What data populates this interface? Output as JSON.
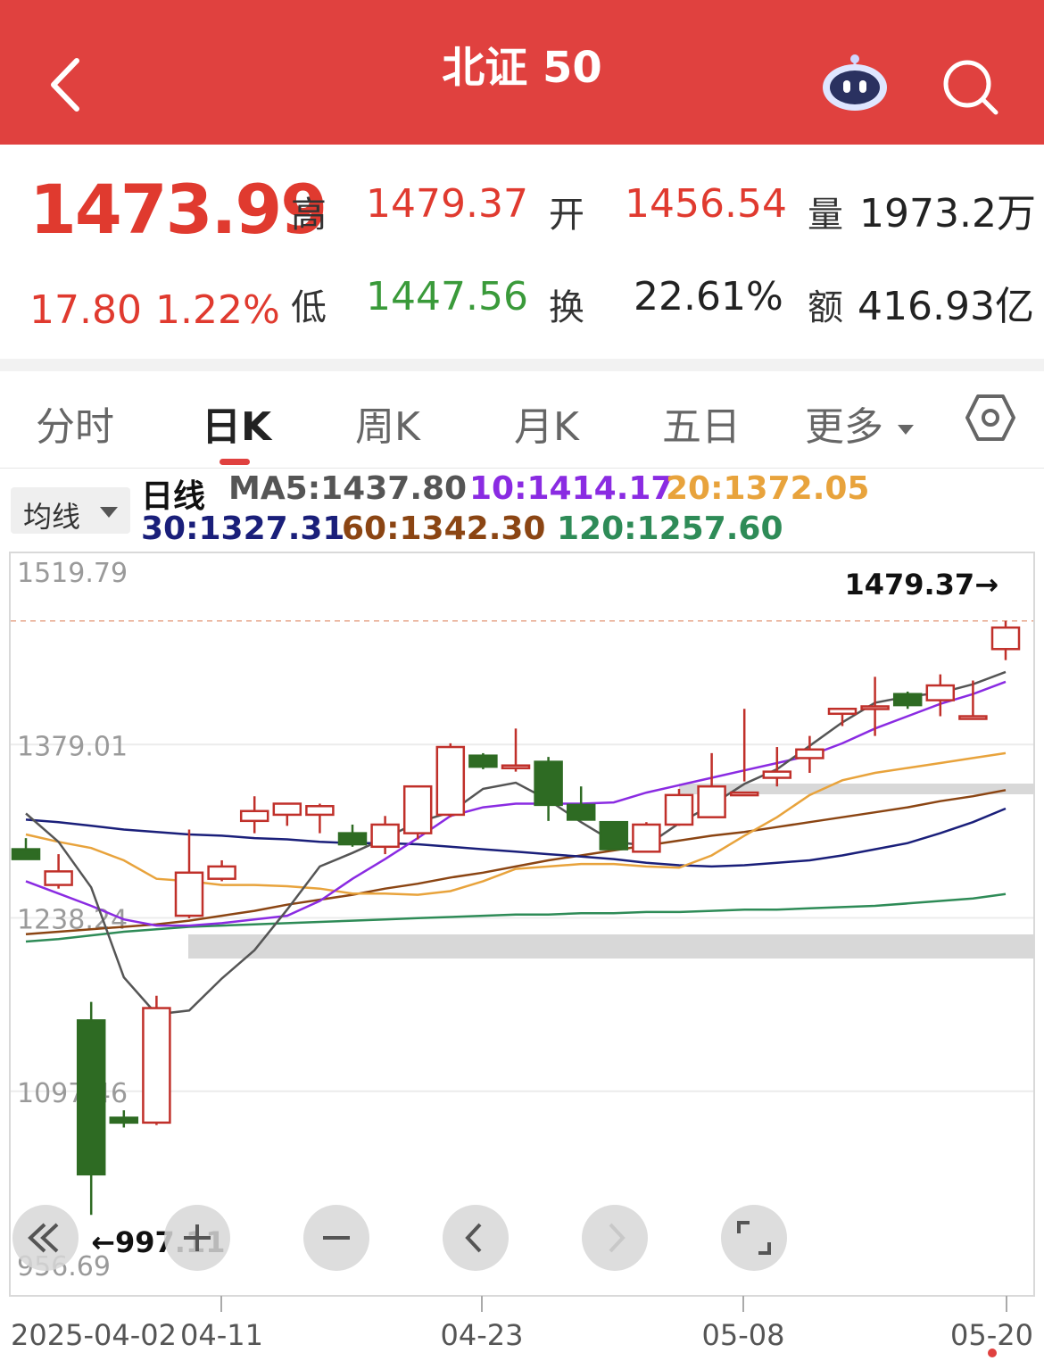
{
  "header": {
    "title": "北证 50"
  },
  "quote": {
    "price": "1473.99",
    "change": "17.80",
    "change_pct": "1.22%",
    "high_label": "高",
    "high": "1479.37",
    "open_label": "开",
    "open": "1456.54",
    "volume_label": "量",
    "volume": "1973.2万",
    "low_label": "低",
    "low": "1447.56",
    "turnover_label": "换",
    "turnover": "22.61%",
    "amount_label": "额",
    "amount": "416.93亿"
  },
  "tabs": [
    {
      "label": "分时"
    },
    {
      "label": "日K"
    },
    {
      "label": "周K"
    },
    {
      "label": "月K"
    },
    {
      "label": "五日"
    },
    {
      "label": "更多"
    }
  ],
  "ma_button": "均线",
  "ma_legend": {
    "period": "日线",
    "ma5": "MA5:1437.80",
    "ma10": "10:1414.17",
    "ma20": "20:1372.05",
    "ma30": "30:1327.31",
    "ma60": "60:1342.30",
    "ma120": "120:1257.60"
  },
  "colors": {
    "up": "#c0302a",
    "down": "#2e6b23",
    "ma5": "#555555",
    "ma10": "#8a2be2",
    "ma20": "#e8a33c",
    "ma30": "#1a1f7a",
    "ma60": "#8b4513",
    "ma120": "#2e8b57",
    "header": "#e0413f"
  },
  "chart_data": {
    "type": "candlestick",
    "y_ticks": [
      "1519.79",
      "1379.01",
      "1238.24",
      "1097.46",
      "956.69"
    ],
    "ylim": [
      956.69,
      1519.79
    ],
    "x_tick_labels": [
      "2025-04-02",
      "04-11",
      "04-23",
      "05-08",
      "05-20"
    ],
    "max_annotation": "1479.37→",
    "min_annotation": "←997.11",
    "candles": [
      {
        "o": 1294,
        "h": 1303,
        "l": 1286,
        "c": 1286
      },
      {
        "o": 1265,
        "h": 1290,
        "l": 1262,
        "c": 1276
      },
      {
        "o": 1155,
        "h": 1170,
        "l": 997.11,
        "c": 1030
      },
      {
        "o": 1076,
        "h": 1082,
        "l": 1068,
        "c": 1072
      },
      {
        "o": 1072,
        "h": 1175,
        "l": 1070,
        "c": 1165
      },
      {
        "o": 1240,
        "h": 1310,
        "l": 1238,
        "c": 1275
      },
      {
        "o": 1270,
        "h": 1285,
        "l": 1268,
        "c": 1280
      },
      {
        "o": 1317,
        "h": 1337,
        "l": 1307,
        "c": 1325
      },
      {
        "o": 1322,
        "h": 1331,
        "l": 1313,
        "c": 1331
      },
      {
        "o": 1322,
        "h": 1331,
        "l": 1307,
        "c": 1329
      },
      {
        "o": 1307,
        "h": 1314,
        "l": 1296,
        "c": 1298
      },
      {
        "o": 1296,
        "h": 1321,
        "l": 1290,
        "c": 1314
      },
      {
        "o": 1307,
        "h": 1338,
        "l": 1302,
        "c": 1345
      },
      {
        "o": 1322,
        "h": 1380,
        "l": 1320,
        "c": 1377
      },
      {
        "o": 1370,
        "h": 1372,
        "l": 1359,
        "c": 1361
      },
      {
        "o": 1362,
        "h": 1392,
        "l": 1357,
        "c": 1362
      },
      {
        "o": 1365,
        "h": 1369,
        "l": 1317,
        "c": 1330
      },
      {
        "o": 1330,
        "h": 1345,
        "l": 1329,
        "c": 1318
      },
      {
        "o": 1316,
        "h": 1316,
        "l": 1294,
        "c": 1294
      },
      {
        "o": 1292,
        "h": 1316,
        "l": 1293,
        "c": 1314
      },
      {
        "o": 1314,
        "h": 1343,
        "l": 1313,
        "c": 1338
      },
      {
        "o": 1320,
        "h": 1372,
        "l": 1320,
        "c": 1345
      },
      {
        "o": 1340,
        "h": 1408,
        "l": 1349,
        "c": 1340
      },
      {
        "o": 1352,
        "h": 1377,
        "l": 1345,
        "c": 1357
      },
      {
        "o": 1368,
        "h": 1386,
        "l": 1356,
        "c": 1375
      },
      {
        "o": 1404,
        "h": 1408,
        "l": 1394,
        "c": 1408
      },
      {
        "o": 1409,
        "h": 1434,
        "l": 1386,
        "c": 1410
      },
      {
        "o": 1420,
        "h": 1422,
        "l": 1408,
        "c": 1411
      },
      {
        "o": 1415,
        "h": 1436,
        "l": 1402,
        "c": 1427
      },
      {
        "o": 1402,
        "h": 1431,
        "l": 1400,
        "c": 1402
      },
      {
        "o": 1456.54,
        "h": 1479.37,
        "l": 1447.56,
        "c": 1473.99
      }
    ],
    "ma5": [
      1323,
      1300,
      1263,
      1190,
      1160,
      1163,
      1189,
      1212,
      1245,
      1280,
      1291,
      1303,
      1316,
      1324,
      1343,
      1348,
      1334,
      1316,
      1300,
      1297,
      1315,
      1330,
      1347,
      1359,
      1378,
      1397,
      1413,
      1418,
      1421,
      1428,
      1438
    ],
    "ma10": [
      1268,
      1258,
      1248,
      1237,
      1232,
      1232,
      1234,
      1237,
      1240,
      1252,
      1270,
      1286,
      1303,
      1321,
      1328,
      1331,
      1331,
      1331,
      1332,
      1340,
      1346,
      1352,
      1358,
      1364,
      1370,
      1380,
      1392,
      1402,
      1412,
      1420,
      1430
    ],
    "ma20": [
      1306,
      1300,
      1295,
      1285,
      1270,
      1268,
      1265,
      1265,
      1264,
      1262,
      1258,
      1258,
      1257,
      1260,
      1268,
      1278,
      1280,
      1282,
      1282,
      1280,
      1279,
      1289,
      1305,
      1320,
      1338,
      1350,
      1356,
      1360,
      1364,
      1368,
      1372
    ],
    "ma30": [
      1318,
      1316,
      1313,
      1310,
      1308,
      1306,
      1305,
      1303,
      1302,
      1300,
      1299,
      1299,
      1298,
      1296,
      1294,
      1292,
      1290,
      1288,
      1286,
      1283,
      1281,
      1280,
      1281,
      1283,
      1285,
      1289,
      1294,
      1299,
      1307,
      1316,
      1327
    ],
    "ma60": [
      1225,
      1227,
      1229,
      1231,
      1233,
      1236,
      1240,
      1244,
      1249,
      1253,
      1257,
      1262,
      1266,
      1271,
      1275,
      1280,
      1285,
      1289,
      1293,
      1297,
      1301,
      1305,
      1308,
      1312,
      1316,
      1320,
      1324,
      1328,
      1333,
      1337,
      1342
    ],
    "ma120": [
      1219,
      1221,
      1224,
      1227,
      1229,
      1231,
      1232,
      1233,
      1234,
      1235,
      1236,
      1237,
      1238,
      1239,
      1240,
      1241,
      1241,
      1242,
      1242,
      1243,
      1243,
      1244,
      1245,
      1245,
      1246,
      1247,
      1248,
      1250,
      1252,
      1254,
      1257.6
    ]
  }
}
